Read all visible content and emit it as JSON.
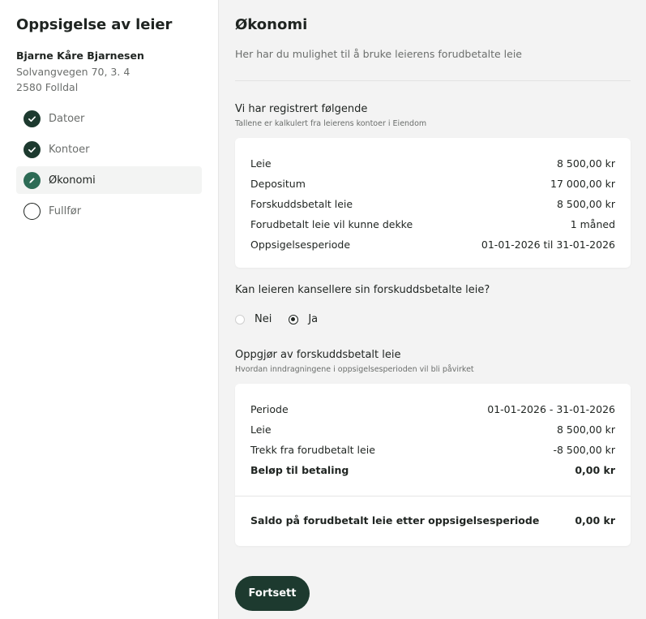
{
  "sidebar": {
    "title": "Oppsigelse av leier",
    "tenant": {
      "name": "Bjarne Kåre Bjarnesen",
      "address": "Solvangvegen 70, 3. 4",
      "postal": "2580 Folldal"
    },
    "steps": [
      {
        "label": "Datoer",
        "state": "done",
        "icon": "check-icon"
      },
      {
        "label": "Kontoer",
        "state": "done",
        "icon": "check-icon"
      },
      {
        "label": "Økonomi",
        "state": "active",
        "icon": "pencil-icon"
      },
      {
        "label": "Fullfør",
        "state": "pending",
        "icon": "empty-circle-icon"
      }
    ]
  },
  "main": {
    "title": "Økonomi",
    "subtitle": "Her har du mulighet til å bruke leierens forudbetalte leie",
    "registered": {
      "title": "Vi har registrert følgende",
      "subtitle": "Tallene er kalkulert fra leierens kontoer i Eiendom",
      "rows": [
        {
          "label": "Leie",
          "value": "8 500,00 kr"
        },
        {
          "label": "Depositum",
          "value": "17 000,00 kr"
        },
        {
          "label": "Forskuddsbetalt leie",
          "value": "8 500,00 kr"
        },
        {
          "label": "Forudbetalt leie vil kunne dekke",
          "value": "1 måned"
        },
        {
          "label": "Oppsigelsesperiode",
          "value": "01-01-2026 til 31-01-2026"
        }
      ]
    },
    "question": {
      "label": "Kan leieren kansellere sin forskuddsbetalte leie?",
      "options": [
        {
          "label": "Nei",
          "checked": false
        },
        {
          "label": "Ja",
          "checked": true
        }
      ]
    },
    "settlement": {
      "title": "Oppgjør av forskuddsbetalt leie",
      "subtitle": "Hvordan inndragningene i oppsigelsesperioden vil bli påvirket",
      "rows": [
        {
          "label": "Periode",
          "value": "01-01-2026 - 31-01-2026"
        },
        {
          "label": "Leie",
          "value": "8 500,00 kr"
        },
        {
          "label": "Trekk fra forudbetalt leie",
          "value": "-8 500,00 kr"
        },
        {
          "label": "Beløp til betaling",
          "value": "0,00 kr"
        }
      ],
      "footer": {
        "label": "Saldo på forudbetalt leie etter oppsigelsesperiode",
        "value": "0,00 kr"
      }
    },
    "continue_label": "Fortsett"
  },
  "colors": {
    "primary": "#1d3a2f",
    "edit": "#2d6b55",
    "background": "#f3f3f3"
  }
}
